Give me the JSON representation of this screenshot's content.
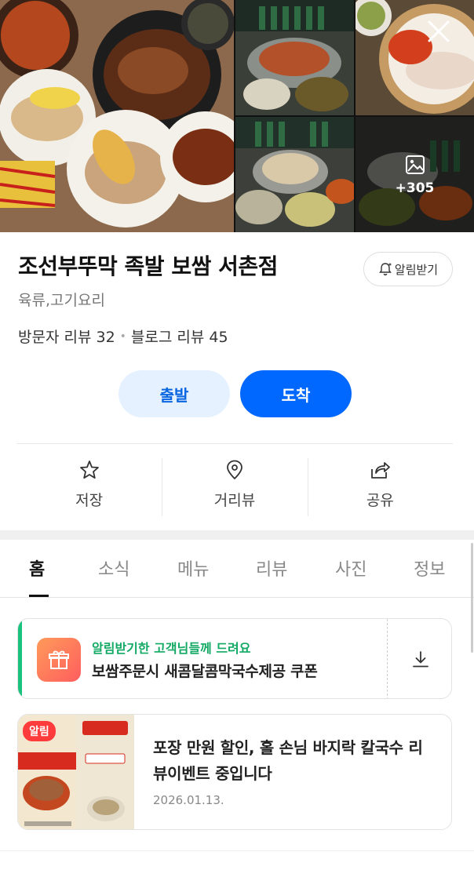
{
  "gallery": {
    "more_count": "+305",
    "image_icon": "image-stack-icon",
    "close_icon": "close-icon"
  },
  "place": {
    "name": "조선부뚜막 족발 보쌈 서촌점",
    "category": "육류,고기요리",
    "visitor_reviews": "방문자 리뷰 32",
    "separator": "•",
    "blog_reviews": "블로그 리뷰 45",
    "alarm_label": "알림받기"
  },
  "route": {
    "depart_label": "출발",
    "arrive_label": "도착"
  },
  "actions": [
    {
      "label": "저장",
      "icon": "star-icon"
    },
    {
      "label": "거리뷰",
      "icon": "map-pin-icon"
    },
    {
      "label": "공유",
      "icon": "share-icon"
    }
  ],
  "tabs": [
    "홈",
    "소식",
    "메뉴",
    "리뷰",
    "사진",
    "정보"
  ],
  "active_tab": "홈",
  "coupon": {
    "subtitle": "알림받기한 고객님들께 드려요",
    "title": "보쌈주문시 새콤달콤막국수제공 쿠폰",
    "icon": "gift-icon",
    "download_icon": "download-icon"
  },
  "news": {
    "badge": "알림",
    "title": "포장 만원 할인, 홀 손님 바지락 칼국수 리뷰이벤트 중입니다",
    "date": "2026.01.13."
  },
  "colors": {
    "primary_blue": "#0068ff",
    "light_blue": "#e5f1ff",
    "coupon_green": "#19c37d",
    "badge_red": "#ff3b3b"
  }
}
